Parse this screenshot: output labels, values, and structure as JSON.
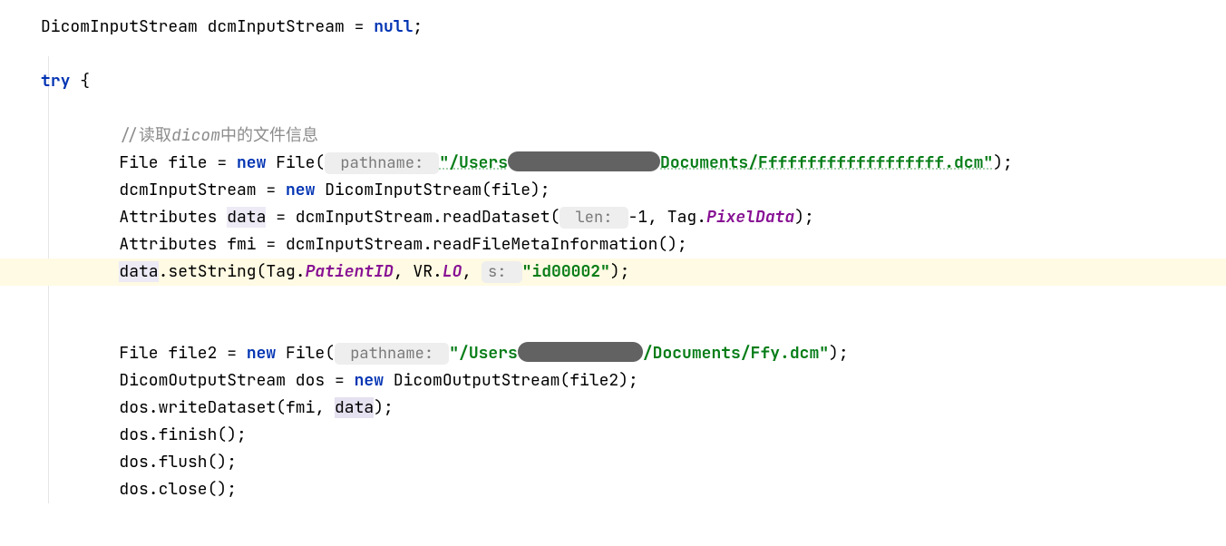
{
  "code": {
    "l1": {
      "t1": "DicomInputStream dcmInputStream = ",
      "null": "null",
      "t2": ";"
    },
    "l2": {
      "try": "try",
      "brace": " {"
    },
    "l3": {
      "indent": "        ",
      "comment_prefix": "//读取",
      "comment_italic": "dicom",
      "comment_suffix": "中的文件信息"
    },
    "l4": {
      "indent": "        File file = ",
      "new": "new",
      "t2": " File(",
      "hint": " pathname: ",
      "str1": "\"/Users",
      "str2": "Documents/Fffffffffffffffffff.dcm\"",
      "t3": ");"
    },
    "l5": {
      "indent": "        dcmInputStream = ",
      "new": "new",
      "t2": " DicomInputStream(file);"
    },
    "l6": {
      "indent": "        Attributes ",
      "data": "data",
      "t2": " = dcmInputStream.readDataset(",
      "hint": " len: ",
      "t3": "-1, Tag.",
      "member": "PixelData",
      "t4": ");"
    },
    "l7": {
      "indent": "        Attributes fmi = dcmInputStream.readFileMetaInformation();"
    },
    "l8": {
      "indent": "        ",
      "data": "data",
      "t2": ".setString(Tag.",
      "member1": "PatientID",
      "t3": ", VR.",
      "member2": "LO",
      "t4": ", ",
      "hint": "s: ",
      "str": "\"id00002\"",
      "t5": ");"
    },
    "l9": {
      "indent": "        File file2 = ",
      "new": "new",
      "t2": " File(",
      "hint": " pathname: ",
      "str1": "\"/Users",
      "str2": "/Documents/Ffy.dcm\"",
      "t3": ");"
    },
    "l10": {
      "indent": "        DicomOutputStream dos = ",
      "new": "new",
      "t2": " DicomOutputStream(file2);"
    },
    "l11": {
      "indent": "        dos.writeDataset(fmi, ",
      "data": "data",
      "t2": ");"
    },
    "l12": {
      "indent": "        dos.finish();"
    },
    "l13": {
      "indent": "        dos.flush();"
    },
    "l14": {
      "indent": "        dos.close();"
    }
  }
}
